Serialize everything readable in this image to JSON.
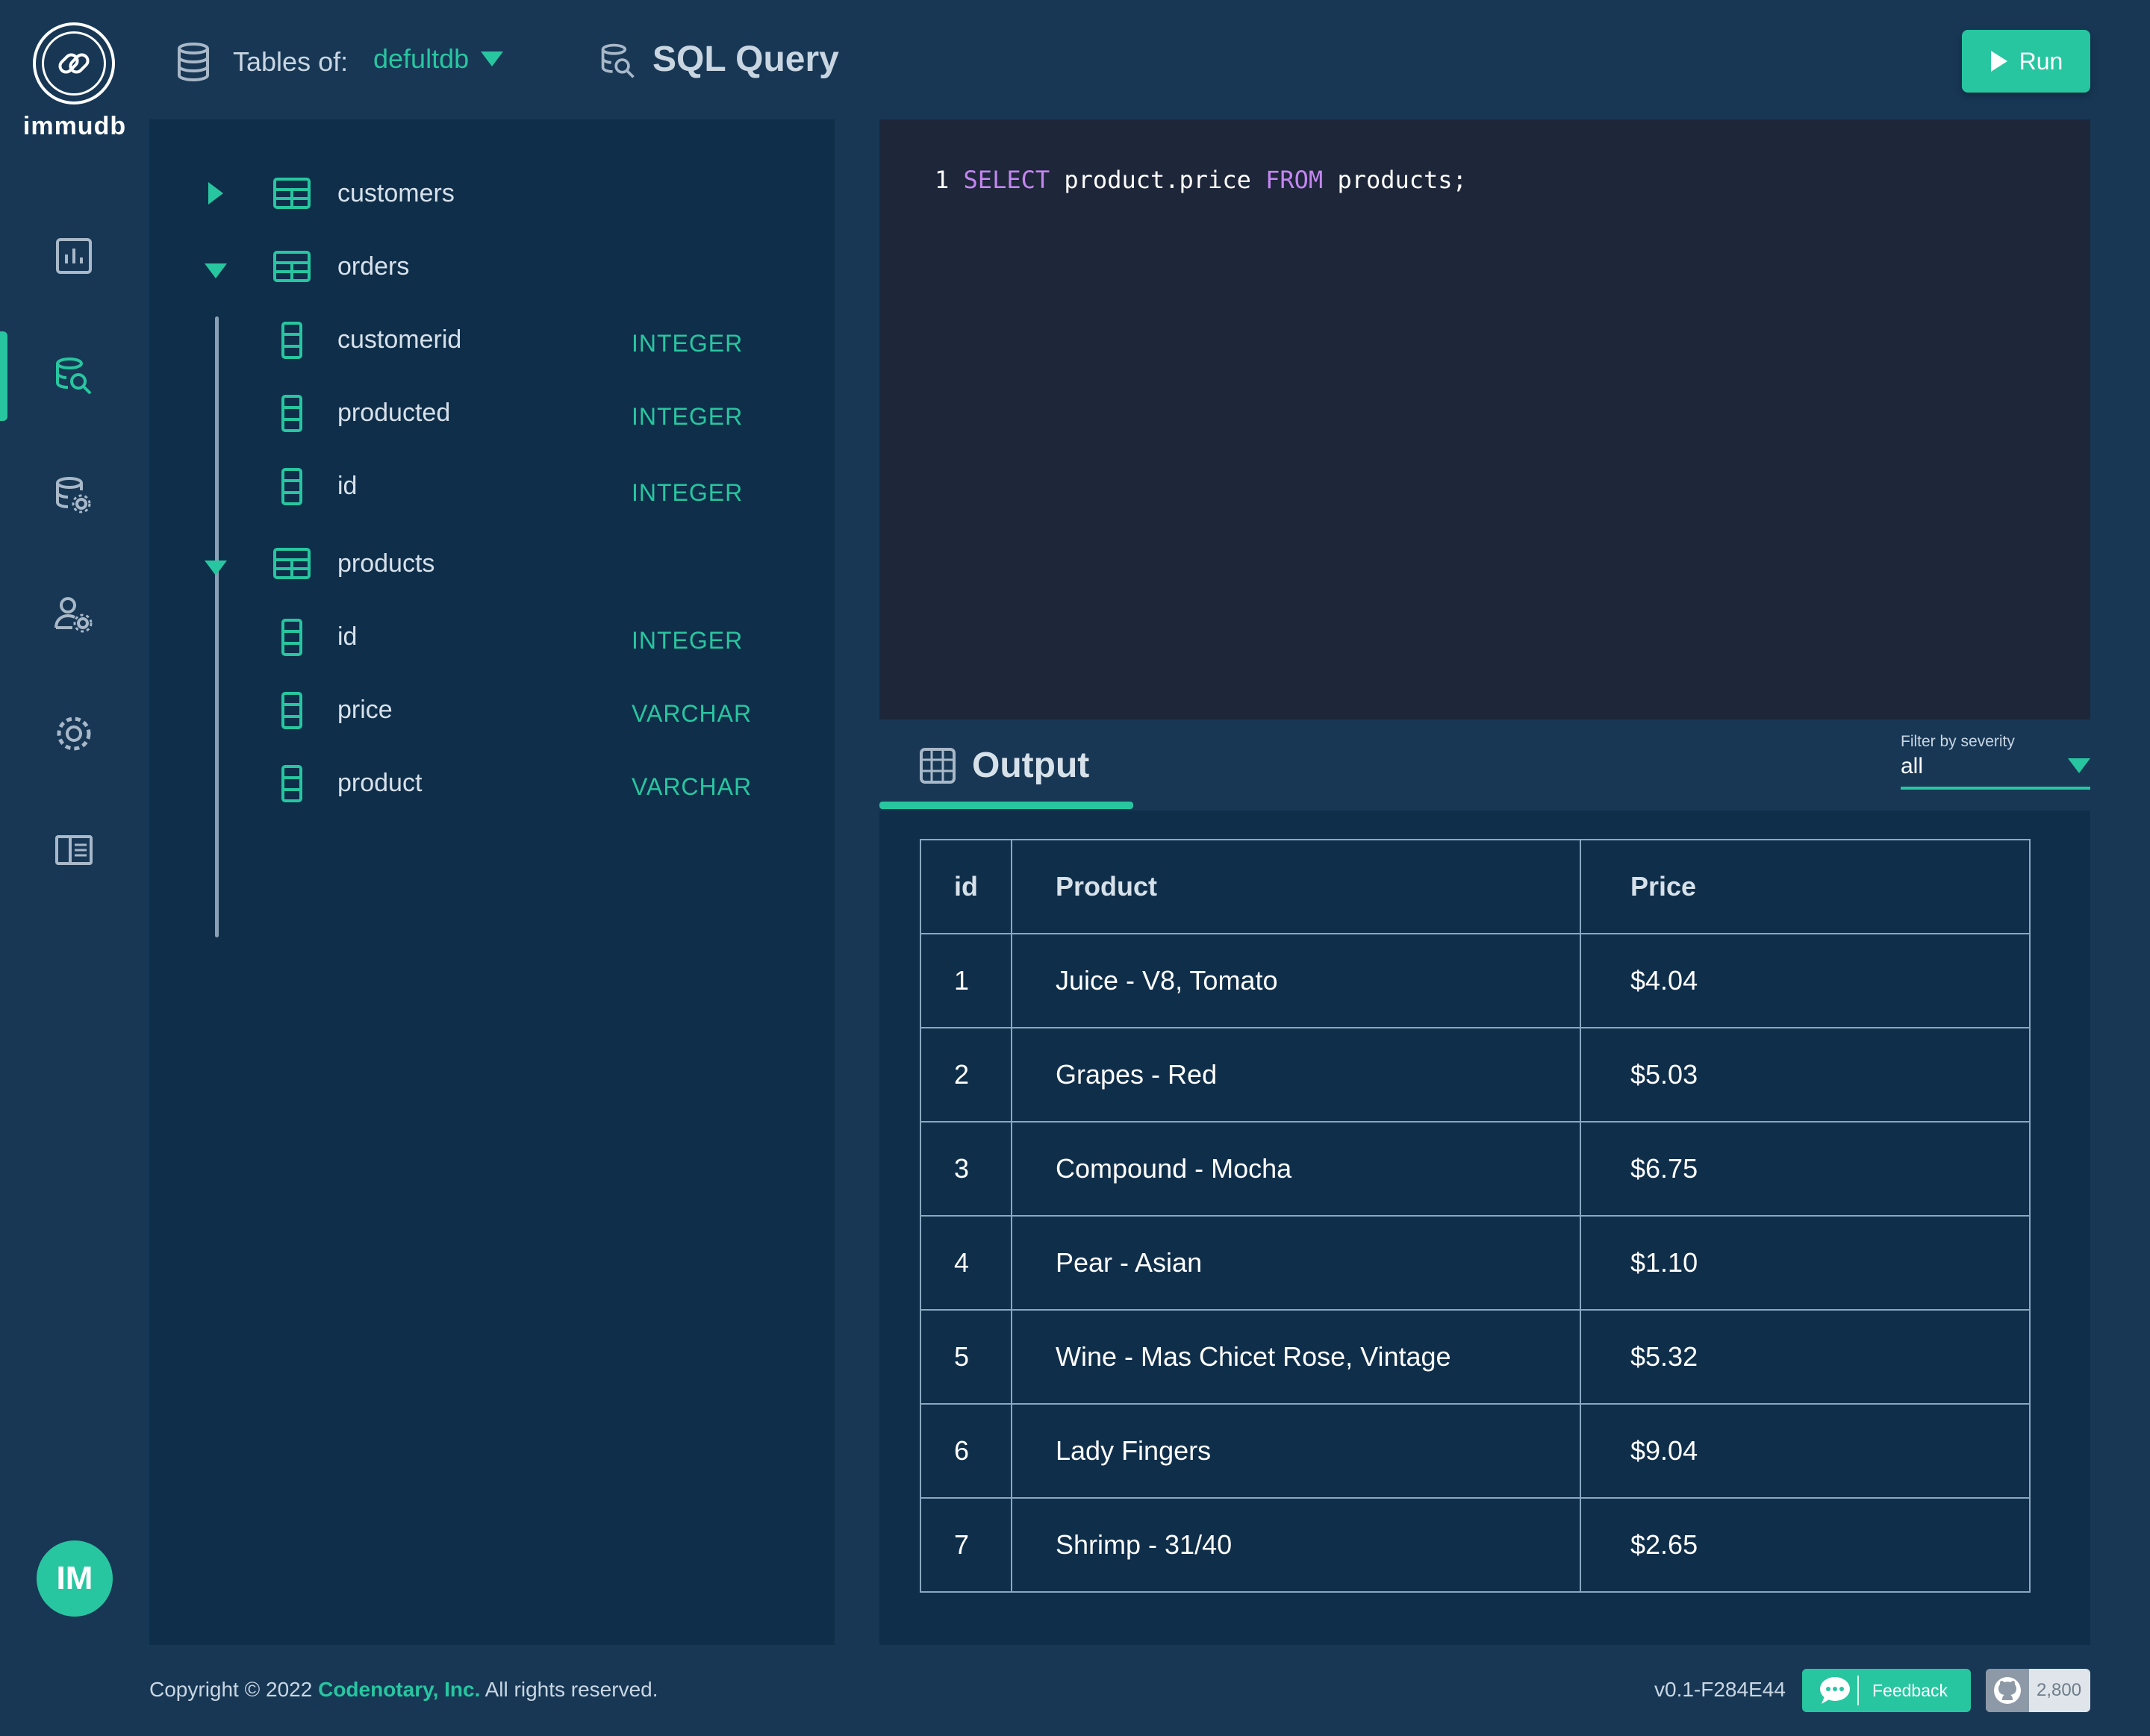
{
  "brand": {
    "name": "immudb"
  },
  "user": {
    "initials": "IM"
  },
  "nav": {
    "items": [
      {
        "icon": "dashboard-icon",
        "active": false
      },
      {
        "icon": "sql-query-icon",
        "active": true
      },
      {
        "icon": "database-settings-icon",
        "active": false
      },
      {
        "icon": "user-settings-icon",
        "active": false
      },
      {
        "icon": "gear-icon",
        "active": false
      },
      {
        "icon": "docs-icon",
        "active": false
      }
    ]
  },
  "header": {
    "tables_of_label": "Tables of:",
    "database": "defultdb",
    "title": "SQL Query",
    "run_label": "Run"
  },
  "tables": {
    "items": [
      {
        "name": "customers",
        "expanded": false,
        "columns": []
      },
      {
        "name": "orders",
        "expanded": true,
        "columns": [
          {
            "name": "customerid",
            "type": "INTEGER"
          },
          {
            "name": "producted",
            "type": "INTEGER"
          },
          {
            "name": "id",
            "type": "INTEGER"
          }
        ]
      },
      {
        "name": "products",
        "expanded": true,
        "columns": [
          {
            "name": "id",
            "type": "INTEGER"
          },
          {
            "name": "price",
            "type": "VARCHAR"
          },
          {
            "name": "product",
            "type": "VARCHAR"
          }
        ]
      }
    ]
  },
  "editor": {
    "line_number": "1",
    "kw_select": "SELECT",
    "expr": "product.price",
    "kw_from": "FROM",
    "table": "products;"
  },
  "output": {
    "title": "Output",
    "filter": {
      "label": "Filter by severity",
      "value": "all"
    },
    "columns": [
      "id",
      "Product",
      "Price"
    ],
    "rows": [
      [
        "1",
        "Juice - V8, Tomato",
        "$4.04"
      ],
      [
        "2",
        "Grapes - Red",
        "$5.03"
      ],
      [
        "3",
        "Compound - Mocha",
        "$6.75"
      ],
      [
        "4",
        "Pear - Asian",
        "$1.10"
      ],
      [
        "5",
        "Wine - Mas Chicet Rose, Vintage",
        "$5.32"
      ],
      [
        "6",
        "Lady Fingers",
        "$9.04"
      ],
      [
        "7",
        "Shrimp - 31/40",
        "$2.65"
      ]
    ]
  },
  "footer": {
    "copyright_prefix": "Copyright © 2022 ",
    "company": "Codenotary, Inc.",
    "copyright_suffix": " All rights reserved.",
    "version": "v0.1-F284E44",
    "feedback_label": "Feedback",
    "github_count": "2,800"
  },
  "colors": {
    "background": "#173755",
    "panel": "#0f2e4a",
    "editor": "#1e2639",
    "accent": "#28c6a0",
    "keyword": "#c386f0"
  }
}
